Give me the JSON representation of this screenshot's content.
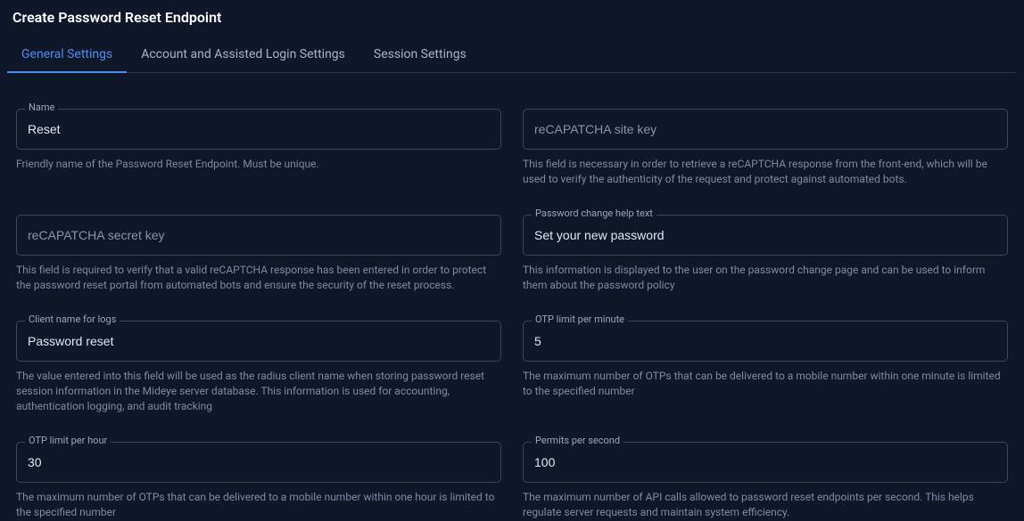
{
  "header": {
    "title": "Create Password Reset Endpoint"
  },
  "tabs": [
    {
      "label": "General Settings",
      "active": true
    },
    {
      "label": "Account and Assisted Login Settings",
      "active": false
    },
    {
      "label": "Session Settings",
      "active": false
    }
  ],
  "fields": {
    "name": {
      "label": "Name",
      "value": "Reset",
      "help": "Friendly name of the Password Reset Endpoint. Must be unique."
    },
    "recaptcha_site_key": {
      "placeholder": "reCAPATCHA site key",
      "value": "",
      "help": "This field is necessary in order to retrieve a reCAPTCHA response from the front-end, which will be used to verify the authenticity of the request and protect against automated bots."
    },
    "recaptcha_secret_key": {
      "placeholder": "reCAPATCHA secret key",
      "value": "",
      "help": "This field is required to verify that a valid reCAPTCHA response has been entered in order to protect the password reset portal from automated bots and ensure the security of the reset process."
    },
    "password_change_help_text": {
      "label": "Password change help text",
      "value": "Set your new password",
      "help": "This information is displayed to the user on the password change page and can be used to inform them about the password policy"
    },
    "client_name_for_logs": {
      "label": "Client name for logs",
      "value": "Password reset",
      "help": "The value entered into this field will be used as the radius client name when storing password reset session information in the Mideye server database. This information is used for accounting, authentication logging, and audit tracking"
    },
    "otp_limit_per_minute": {
      "label": "OTP limit per minute",
      "value": "5",
      "help": "The maximum number of OTPs that can be delivered to a mobile number within one minute is limited to the specified number"
    },
    "otp_limit_per_hour": {
      "label": "OTP limit per hour",
      "value": "30",
      "help": "The maximum number of OTPs that can be delivered to a mobile number within one hour is limited to the specified number"
    },
    "permits_per_second": {
      "label": "Permits per second",
      "value": "100",
      "help": "The maximum number of API calls allowed to password reset endpoints per second. This helps regulate server requests and maintain system efficiency."
    }
  }
}
